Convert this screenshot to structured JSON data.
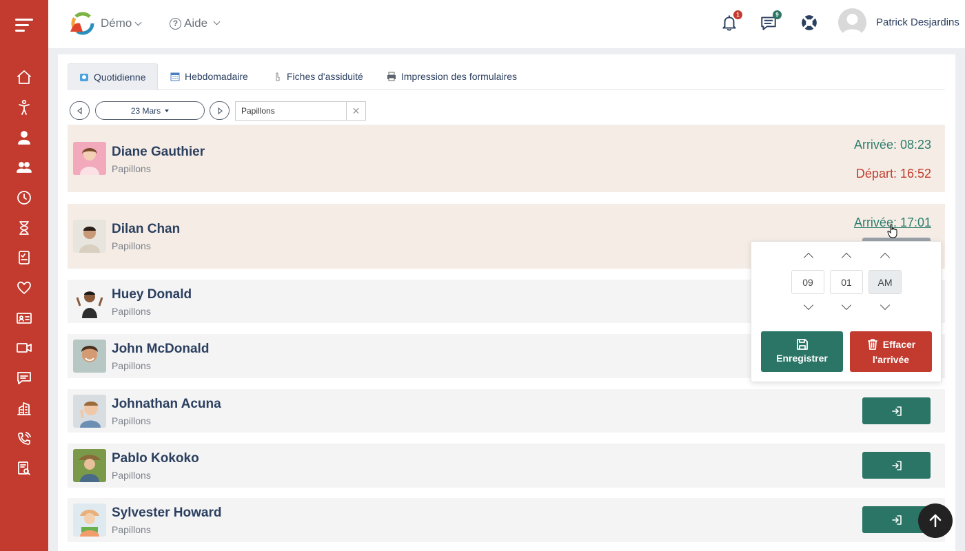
{
  "header": {
    "demo_label": "Démo",
    "help_label": "Aide",
    "notifications_count": "1",
    "messages_count": "9",
    "user_name": "Patrick Desjardins"
  },
  "colors": {
    "sidebar": "#c23b2e",
    "teal": "#2a7566",
    "red": "#c23b2e",
    "navy": "#2b3f5f"
  },
  "sidebar": {
    "items": [
      "home-icon",
      "child-icon",
      "staff-icon",
      "group-icon",
      "clock-icon",
      "hourglass-icon",
      "checklist-icon",
      "heart-icon",
      "id-card-icon",
      "video-icon",
      "chat-icon",
      "building-icon",
      "phone-icon",
      "report-icon"
    ]
  },
  "tabs": [
    {
      "label": "Quotidienne",
      "icon": "daily-icon"
    },
    {
      "label": "Hebdomadaire",
      "icon": "calendar-icon"
    },
    {
      "label": "Fiches d'assiduité",
      "icon": "pointer-icon"
    },
    {
      "label": "Impression des formulaires",
      "icon": "printer-icon"
    }
  ],
  "toolbar": {
    "date_label": "23 Mars",
    "search_value": "Papillons"
  },
  "children": [
    {
      "name": "Diane Gauthier",
      "group": "Papillons",
      "arrival": "Arrivée: 08:23",
      "departure": "Départ: 16:52"
    },
    {
      "name": "Dilan Chan",
      "group": "Papillons",
      "arrival": "Arrivée: 17:01"
    },
    {
      "name": "Huey Donald",
      "group": "Papillons"
    },
    {
      "name": "John McDonald",
      "group": "Papillons"
    },
    {
      "name": "Johnathan Acuna",
      "group": "Papillons"
    },
    {
      "name": "Pablo Kokoko",
      "group": "Papillons"
    },
    {
      "name": "Sylvester Howard",
      "group": "Papillons"
    }
  ],
  "time_picker": {
    "hours": "09",
    "minutes": "01",
    "period": "AM",
    "save_label": "Enregistrer",
    "clear_label_1": "Effacer",
    "clear_label_2": "l'arrivée"
  }
}
